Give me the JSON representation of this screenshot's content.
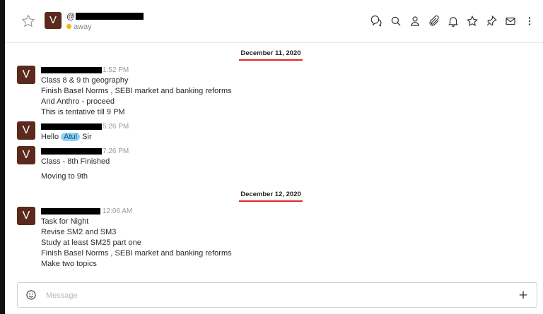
{
  "header": {
    "username_prefix": "@",
    "avatar_letter": "V",
    "status": "away",
    "status_color": "#f5b40a",
    "toolbar_icons": [
      "thread-icon",
      "search-icon",
      "user-info-icon",
      "attachment-icon",
      "notification-bell-icon",
      "star-icon",
      "pinned-icon",
      "mail-icon",
      "kebab-menu-icon"
    ]
  },
  "messages_area": {
    "day1": "December 11, 2020",
    "day2": "December 12, 2020",
    "messages": [
      {
        "avatar": "V",
        "time": "1:52 PM",
        "lines": [
          "Class 8 & 9 th geography",
          "Finish Basel Norms , SEBI market and banking reforms",
          "And Anthro - proceed",
          "This is tentative till 9 PM"
        ]
      },
      {
        "avatar": "V",
        "time": "5:26 PM",
        "text_before": "Hello",
        "mention": "Atul",
        "text_after": "Sir"
      },
      {
        "avatar": "V",
        "time": "7:26 PM",
        "lines": [
          "Class - 8th Finished",
          "Moving to 9th"
        ]
      },
      {
        "avatar": "V",
        "time": "12:06 AM",
        "lines": [
          "Task for Night",
          "Revise SM2 and SM3",
          "Study at least SM25 part one",
          "Finish Basel Norms , SEBI market and banking reforms",
          "Make two topics"
        ]
      }
    ]
  },
  "composer": {
    "placeholder": "Message"
  },
  "colors": {
    "avatar_bg": "#5b2a1c",
    "divider_underline": "#e0252c",
    "mention_bg": "#8fd3f6"
  }
}
